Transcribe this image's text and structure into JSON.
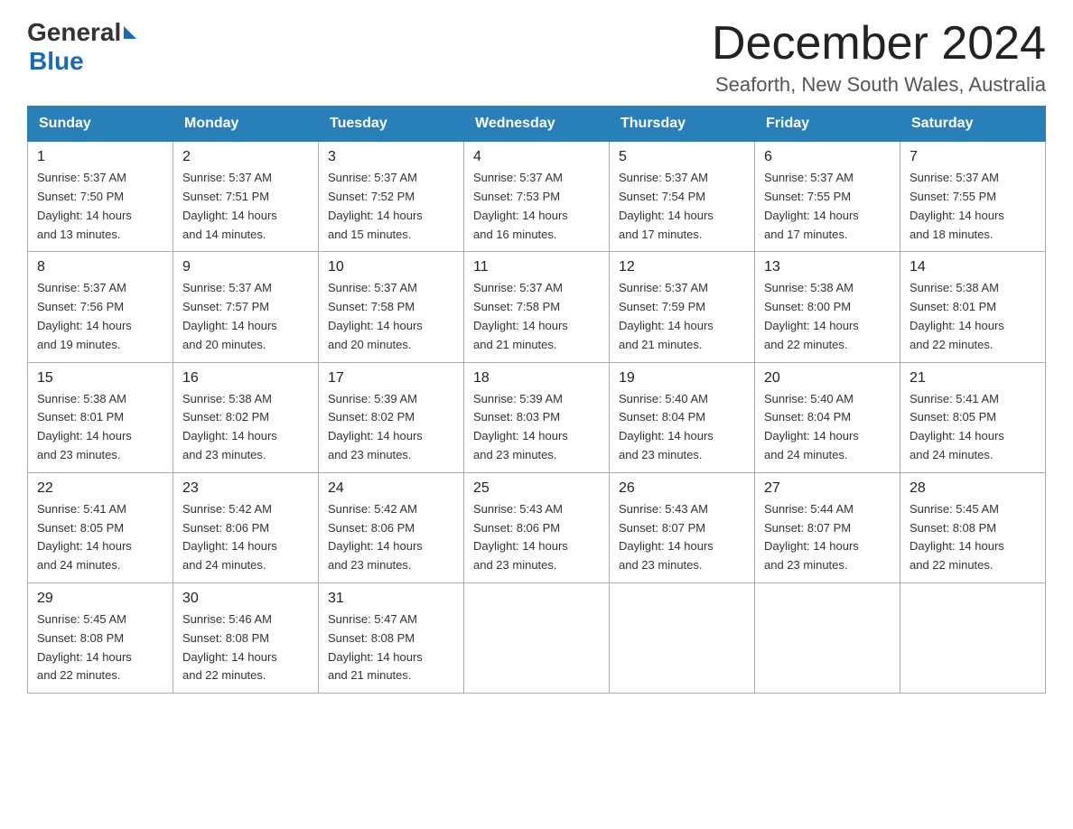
{
  "logo": {
    "general": "General",
    "blue": "Blue"
  },
  "title": "December 2024",
  "location": "Seaforth, New South Wales, Australia",
  "days_header": [
    "Sunday",
    "Monday",
    "Tuesday",
    "Wednesday",
    "Thursday",
    "Friday",
    "Saturday"
  ],
  "weeks": [
    [
      {
        "day": "1",
        "sunrise": "5:37 AM",
        "sunset": "7:50 PM",
        "daylight": "14 hours and 13 minutes."
      },
      {
        "day": "2",
        "sunrise": "5:37 AM",
        "sunset": "7:51 PM",
        "daylight": "14 hours and 14 minutes."
      },
      {
        "day": "3",
        "sunrise": "5:37 AM",
        "sunset": "7:52 PM",
        "daylight": "14 hours and 15 minutes."
      },
      {
        "day": "4",
        "sunrise": "5:37 AM",
        "sunset": "7:53 PM",
        "daylight": "14 hours and 16 minutes."
      },
      {
        "day": "5",
        "sunrise": "5:37 AM",
        "sunset": "7:54 PM",
        "daylight": "14 hours and 17 minutes."
      },
      {
        "day": "6",
        "sunrise": "5:37 AM",
        "sunset": "7:55 PM",
        "daylight": "14 hours and 17 minutes."
      },
      {
        "day": "7",
        "sunrise": "5:37 AM",
        "sunset": "7:55 PM",
        "daylight": "14 hours and 18 minutes."
      }
    ],
    [
      {
        "day": "8",
        "sunrise": "5:37 AM",
        "sunset": "7:56 PM",
        "daylight": "14 hours and 19 minutes."
      },
      {
        "day": "9",
        "sunrise": "5:37 AM",
        "sunset": "7:57 PM",
        "daylight": "14 hours and 20 minutes."
      },
      {
        "day": "10",
        "sunrise": "5:37 AM",
        "sunset": "7:58 PM",
        "daylight": "14 hours and 20 minutes."
      },
      {
        "day": "11",
        "sunrise": "5:37 AM",
        "sunset": "7:58 PM",
        "daylight": "14 hours and 21 minutes."
      },
      {
        "day": "12",
        "sunrise": "5:37 AM",
        "sunset": "7:59 PM",
        "daylight": "14 hours and 21 minutes."
      },
      {
        "day": "13",
        "sunrise": "5:38 AM",
        "sunset": "8:00 PM",
        "daylight": "14 hours and 22 minutes."
      },
      {
        "day": "14",
        "sunrise": "5:38 AM",
        "sunset": "8:01 PM",
        "daylight": "14 hours and 22 minutes."
      }
    ],
    [
      {
        "day": "15",
        "sunrise": "5:38 AM",
        "sunset": "8:01 PM",
        "daylight": "14 hours and 23 minutes."
      },
      {
        "day": "16",
        "sunrise": "5:38 AM",
        "sunset": "8:02 PM",
        "daylight": "14 hours and 23 minutes."
      },
      {
        "day": "17",
        "sunrise": "5:39 AM",
        "sunset": "8:02 PM",
        "daylight": "14 hours and 23 minutes."
      },
      {
        "day": "18",
        "sunrise": "5:39 AM",
        "sunset": "8:03 PM",
        "daylight": "14 hours and 23 minutes."
      },
      {
        "day": "19",
        "sunrise": "5:40 AM",
        "sunset": "8:04 PM",
        "daylight": "14 hours and 23 minutes."
      },
      {
        "day": "20",
        "sunrise": "5:40 AM",
        "sunset": "8:04 PM",
        "daylight": "14 hours and 24 minutes."
      },
      {
        "day": "21",
        "sunrise": "5:41 AM",
        "sunset": "8:05 PM",
        "daylight": "14 hours and 24 minutes."
      }
    ],
    [
      {
        "day": "22",
        "sunrise": "5:41 AM",
        "sunset": "8:05 PM",
        "daylight": "14 hours and 24 minutes."
      },
      {
        "day": "23",
        "sunrise": "5:42 AM",
        "sunset": "8:06 PM",
        "daylight": "14 hours and 24 minutes."
      },
      {
        "day": "24",
        "sunrise": "5:42 AM",
        "sunset": "8:06 PM",
        "daylight": "14 hours and 23 minutes."
      },
      {
        "day": "25",
        "sunrise": "5:43 AM",
        "sunset": "8:06 PM",
        "daylight": "14 hours and 23 minutes."
      },
      {
        "day": "26",
        "sunrise": "5:43 AM",
        "sunset": "8:07 PM",
        "daylight": "14 hours and 23 minutes."
      },
      {
        "day": "27",
        "sunrise": "5:44 AM",
        "sunset": "8:07 PM",
        "daylight": "14 hours and 23 minutes."
      },
      {
        "day": "28",
        "sunrise": "5:45 AM",
        "sunset": "8:08 PM",
        "daylight": "14 hours and 22 minutes."
      }
    ],
    [
      {
        "day": "29",
        "sunrise": "5:45 AM",
        "sunset": "8:08 PM",
        "daylight": "14 hours and 22 minutes."
      },
      {
        "day": "30",
        "sunrise": "5:46 AM",
        "sunset": "8:08 PM",
        "daylight": "14 hours and 22 minutes."
      },
      {
        "day": "31",
        "sunrise": "5:47 AM",
        "sunset": "8:08 PM",
        "daylight": "14 hours and 21 minutes."
      },
      null,
      null,
      null,
      null
    ]
  ],
  "labels": {
    "sunrise": "Sunrise:",
    "sunset": "Sunset:",
    "daylight": "Daylight:"
  }
}
